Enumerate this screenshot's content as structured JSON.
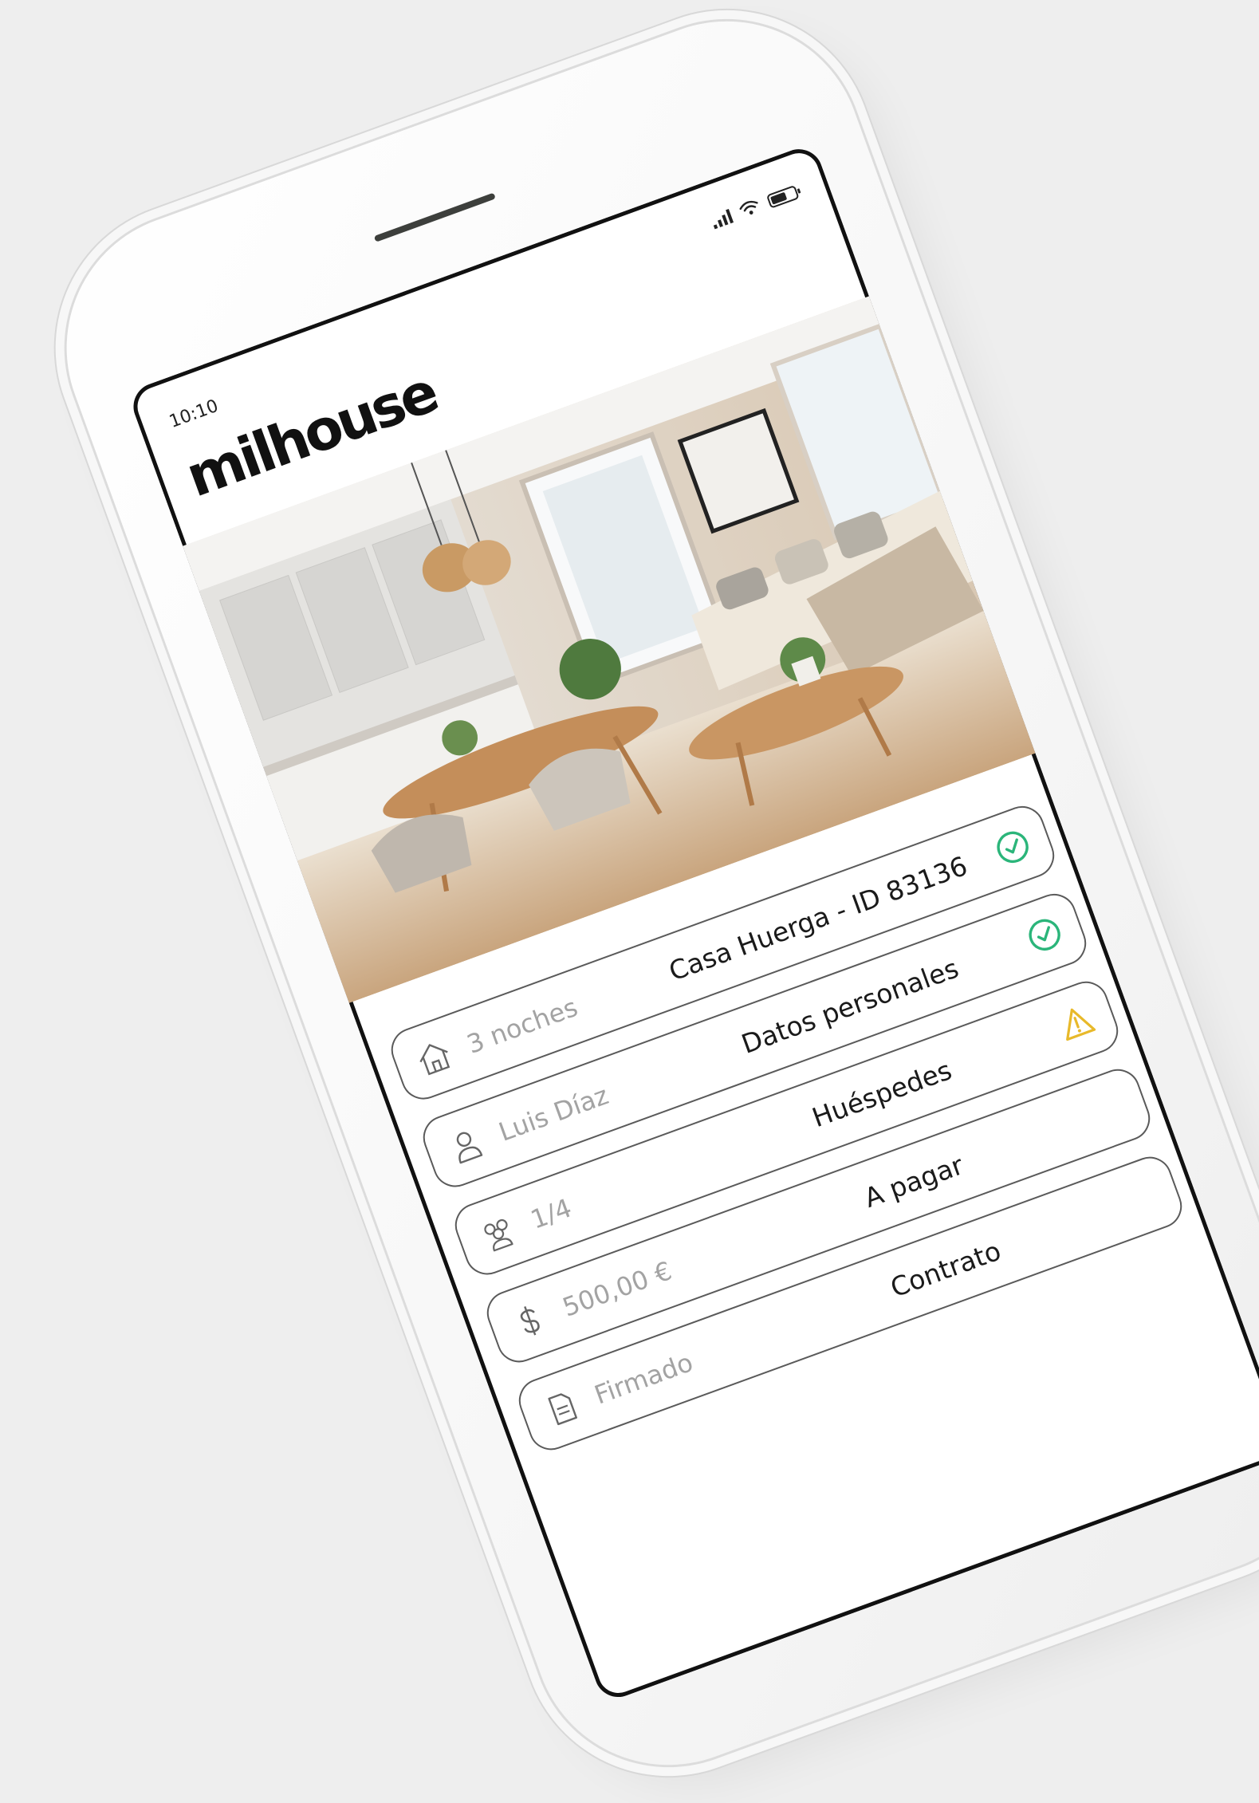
{
  "status_bar": {
    "time": "10:10"
  },
  "app": {
    "logo": "milhouse"
  },
  "hero_image": {
    "alt": ""
  },
  "items": [
    {
      "icon": "house-icon",
      "value": "3 noches",
      "title": "Casa Huerga - ID 83136",
      "status": "check-circle-icon"
    },
    {
      "icon": "user-icon",
      "value": "Luis Díaz",
      "title": "Datos personales",
      "status": "check-circle-icon"
    },
    {
      "icon": "users-icon",
      "value": "1/4",
      "title": "Huéspedes",
      "status": "warning-triangle-icon"
    },
    {
      "icon": "dollar-icon",
      "value": "500,00 €",
      "title": "A pagar",
      "status": ""
    },
    {
      "icon": "document-icon",
      "value": "Firmado",
      "title": "Contrato",
      "status": ""
    }
  ],
  "colors": {
    "success": "#2bb57a",
    "warning": "#e8b92a",
    "text": "#1a1a1a",
    "muted": "#a3a3a3"
  }
}
